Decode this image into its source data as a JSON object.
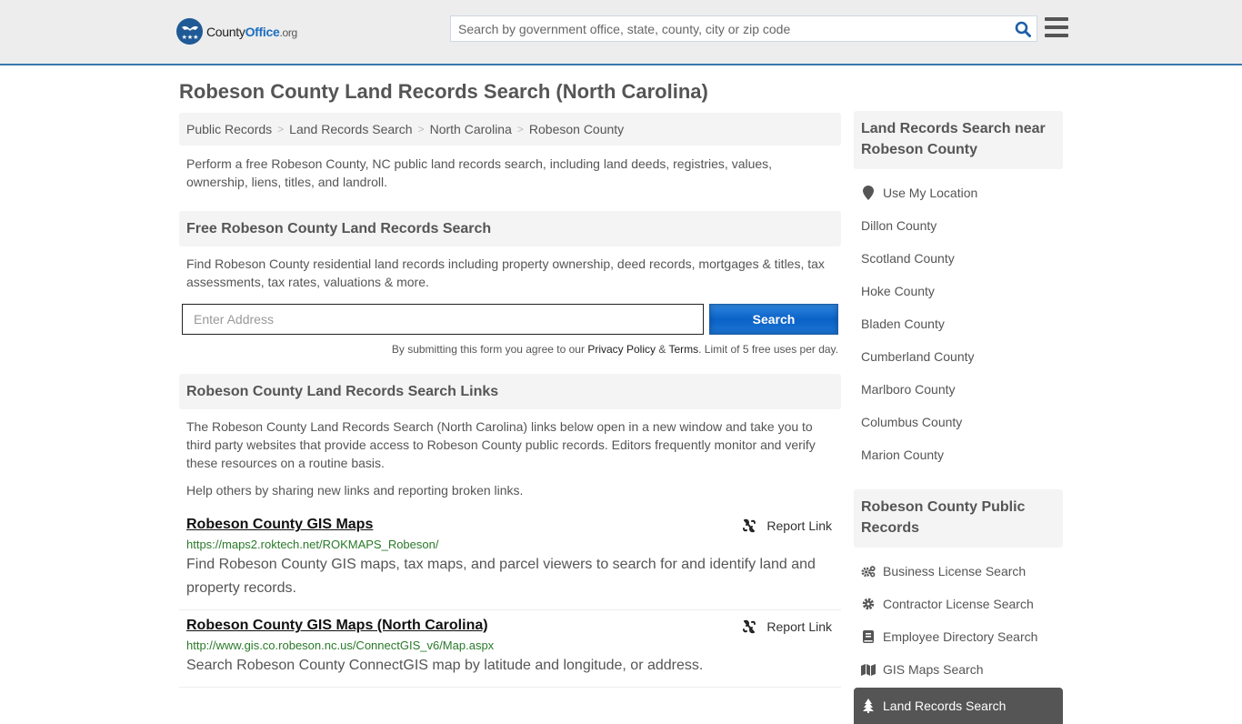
{
  "header": {
    "logo": {
      "name_plain": "County",
      "name_bold": "Office",
      "tld": ".org"
    },
    "search_placeholder": "Search by government office, state, county, city or zip code",
    "search_icon": "search-icon",
    "menu_icon": "hamburger-menu-icon"
  },
  "page": {
    "title": "Robeson County Land Records Search (North Carolina)"
  },
  "breadcrumb": [
    {
      "label": "Public Records"
    },
    {
      "label": "Land Records Search"
    },
    {
      "label": "North Carolina"
    },
    {
      "label": "Robeson County"
    }
  ],
  "intro": "Perform a free Robeson County, NC public land records search, including land deeds, registries, values, ownership, liens, titles, and landroll.",
  "free_search": {
    "heading": "Free Robeson County Land Records Search",
    "description": "Find Robeson County residential land records including property ownership, deed records, mortgages & titles, tax assessments, tax rates, valuations & more.",
    "address_placeholder": "Enter Address",
    "address_value": "",
    "button_label": "Search",
    "disclaimer_prefix": "By submitting this form you agree to our ",
    "privacy_label": "Privacy Policy",
    "amp": " & ",
    "terms_label": "Terms",
    "disclaimer_suffix": ". Limit of 5 free uses per day."
  },
  "links_section": {
    "heading": "Robeson County Land Records Search Links",
    "description": "The Robeson County Land Records Search (North Carolina) links below open in a new window and take you to third party websites that provide access to Robeson County public records. Editors frequently monitor and verify these resources on a routine basis.",
    "help_prefix": "Help others by sharing ",
    "help_link": "new links",
    "help_suffix": " and reporting broken links.",
    "report_label": "Report Link",
    "items": [
      {
        "title": "Robeson County GIS Maps",
        "url": "https://maps2.roktech.net/ROKMAPS_Robeson/",
        "description": "Find Robeson County GIS maps, tax maps, and parcel viewers to search for and identify land and property records."
      },
      {
        "title": "Robeson County GIS Maps (North Carolina)",
        "url": "http://www.gis.co.robeson.nc.us/ConnectGIS_v6/Map.aspx",
        "description": "Search Robeson County ConnectGIS map by latitude and longitude, or address."
      }
    ]
  },
  "sidebar": {
    "nearby": {
      "heading": "Land Records Search near Robeson County",
      "use_location": "Use My Location",
      "counties": [
        "Dillon County",
        "Scotland County",
        "Hoke County",
        "Bladen County",
        "Cumberland County",
        "Marlboro County",
        "Columbus County",
        "Marion County"
      ]
    },
    "public_records": {
      "heading": "Robeson County Public Records",
      "items": [
        {
          "label": "Business License Search",
          "icon": "gears-icon"
        },
        {
          "label": "Contractor License Search",
          "icon": "gear-icon"
        },
        {
          "label": "Employee Directory Search",
          "icon": "book-icon"
        },
        {
          "label": "GIS Maps Search",
          "icon": "map-icon"
        },
        {
          "label": "Land Records Search",
          "icon": "tree-icon",
          "active": true
        }
      ]
    }
  },
  "colors": {
    "accent_blue": "#1d6fc1",
    "header_border": "#3b78ab",
    "url_green": "#2a7a2a",
    "active_bg": "#555555"
  }
}
